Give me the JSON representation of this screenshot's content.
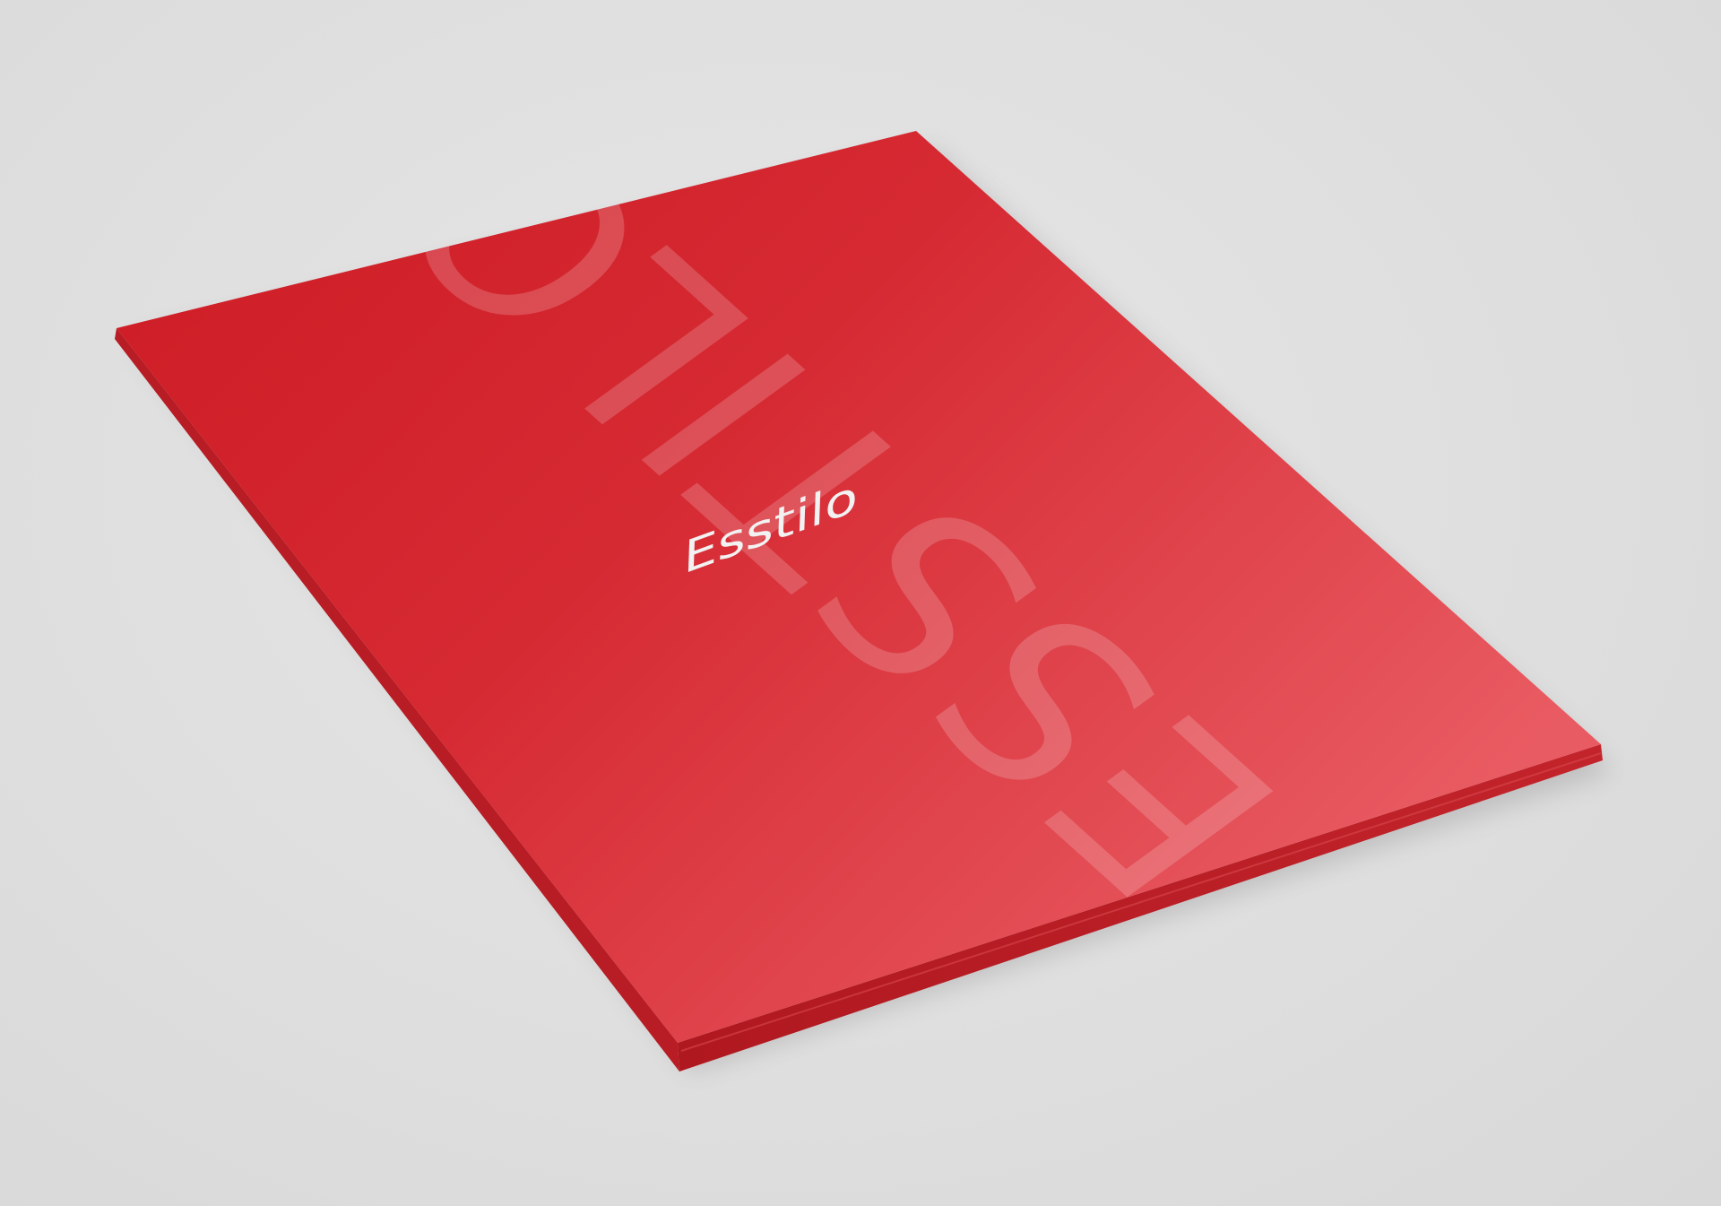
{
  "cover": {
    "title": "Esstilo",
    "watermark": "ESSTILO"
  },
  "colors": {
    "background": "#e0e0e0",
    "cover_red": "#d42027",
    "cover_red_light": "#e2555b",
    "text": "#f2f2f2"
  }
}
